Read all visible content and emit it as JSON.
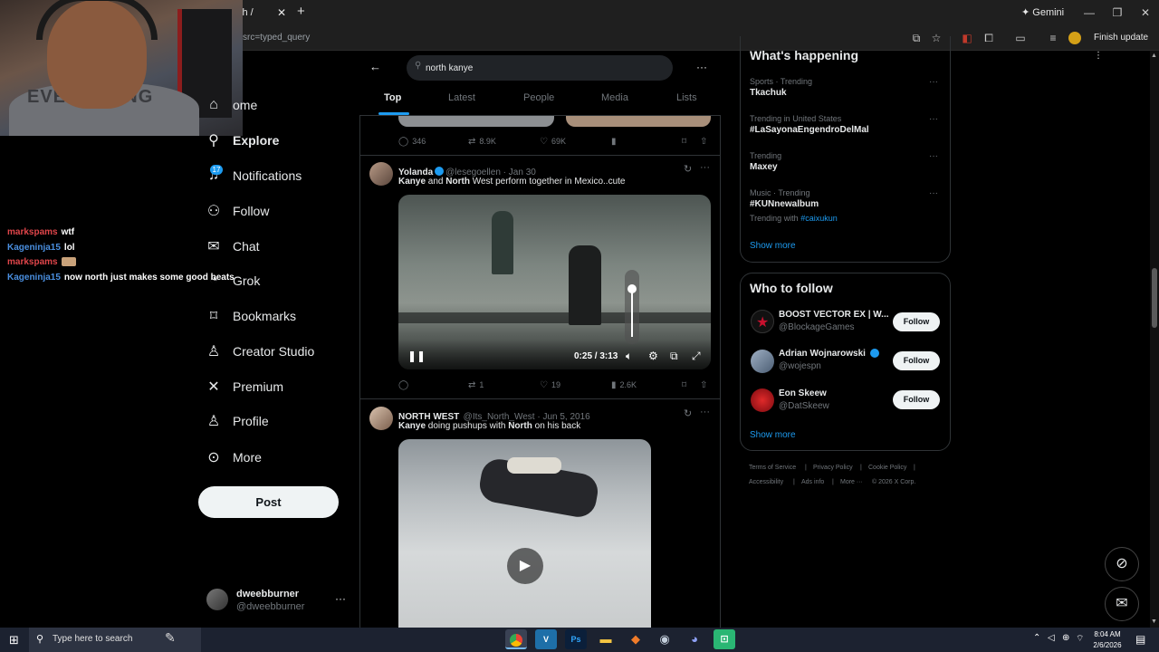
{
  "browser": {
    "tab_title": "ch /",
    "gemini_label": "Gemini",
    "url_fragment": "src=typed_query",
    "finish_update_label": "Finish update"
  },
  "chat": [
    {
      "user": "markspams",
      "message": "wtf",
      "emote": false
    },
    {
      "user": "Kageninja15",
      "message": "lol",
      "emote": false
    },
    {
      "user": "markspams",
      "message": "",
      "emote": true
    },
    {
      "user": "Kageninja15",
      "message": "now north just makes some good beats",
      "emote": false
    }
  ],
  "webcam": {
    "shirt_text": "EVERYTHING"
  },
  "nav": {
    "items": [
      {
        "label": "ome",
        "icon": "home-icon"
      },
      {
        "label": "Explore",
        "icon": "search-icon"
      },
      {
        "label": "Notifications",
        "icon": "bell-icon"
      },
      {
        "label": "Follow",
        "icon": "add-user-icon"
      },
      {
        "label": "Chat",
        "icon": "mail-icon"
      },
      {
        "label": "Grok",
        "icon": "grok-icon"
      },
      {
        "label": "Bookmarks",
        "icon": "bookmark-icon"
      },
      {
        "label": "Creator Studio",
        "icon": "creator-icon"
      },
      {
        "label": "Premium",
        "icon": "x-icon"
      },
      {
        "label": "Profile",
        "icon": "user-icon"
      },
      {
        "label": "More",
        "icon": "more-circle-icon"
      }
    ],
    "notifications_badge": "17",
    "post_label": "Post",
    "account": {
      "name": "dweebburner",
      "handle": "@dweebburner"
    }
  },
  "search": {
    "query": "north kanye",
    "tabs": [
      "Top",
      "Latest",
      "People",
      "Media",
      "Lists"
    ],
    "active_tab": "Top"
  },
  "tweets": [
    {
      "actions": {
        "replies": "346",
        "reposts": "8.9K",
        "likes": "69K",
        "views": ""
      }
    },
    {
      "name": "Yolanda",
      "handle": "@lesegoellen",
      "date": "Jan 30",
      "text_parts": [
        "Kanye",
        " and ",
        "North",
        " West perform together in Mexico..cute"
      ],
      "video_time": "0:25 / 3:13",
      "actions": {
        "replies": "",
        "reposts": "1",
        "likes": "19",
        "views": "2.6K"
      }
    },
    {
      "name": "NORTH WEST",
      "handle": "@Its_North_West",
      "date": "Jun 5, 2016",
      "text_parts": [
        "Kanye",
        " doing pushups with ",
        "North",
        " on his back"
      ]
    }
  ],
  "whats_happening": {
    "title": "What's happening",
    "trends": [
      {
        "category": "Sports · Trending",
        "name": "Tkachuk",
        "extra": ""
      },
      {
        "category": "Trending in United States",
        "name": "#LaSayonaEngendroDelMal",
        "extra": ""
      },
      {
        "category": "Trending",
        "name": "Maxey",
        "extra": ""
      },
      {
        "category": "Music · Trending",
        "name": "#KUNnewalbum",
        "extra_prefix": "Trending with ",
        "extra": "#caixukun"
      }
    ],
    "show_more": "Show more"
  },
  "who_to_follow": {
    "title": "Who to follow",
    "accounts": [
      {
        "name": "BOOST VECTOR EX | W...",
        "handle": "@BlockageGames",
        "avatar_color": "#c8102e"
      },
      {
        "name": "Adrian Wojnarowski",
        "handle": "@wojespn",
        "avatar_color": "#7a8ea8"
      },
      {
        "name": "Eon Skeew",
        "handle": "@DatSkeew",
        "avatar_color": "#b01018"
      }
    ],
    "follow_label": "Follow",
    "show_more": "Show more"
  },
  "footer": {
    "links": [
      "Terms of Service",
      "Privacy Policy",
      "Cookie Policy",
      "Accessibility",
      "Ads info",
      "More ···",
      "© 2026 X Corp."
    ]
  },
  "taskbar": {
    "search_placeholder": "Type here to search",
    "apps": [
      "chrome",
      "V",
      "Ps",
      "files",
      "app",
      "steam",
      "discord",
      "app2"
    ],
    "time": "8:04 AM",
    "date": "2/6/2026"
  },
  "colors": {
    "accent": "#1d9bf0",
    "background": "#000000",
    "border": "#2f3336"
  }
}
